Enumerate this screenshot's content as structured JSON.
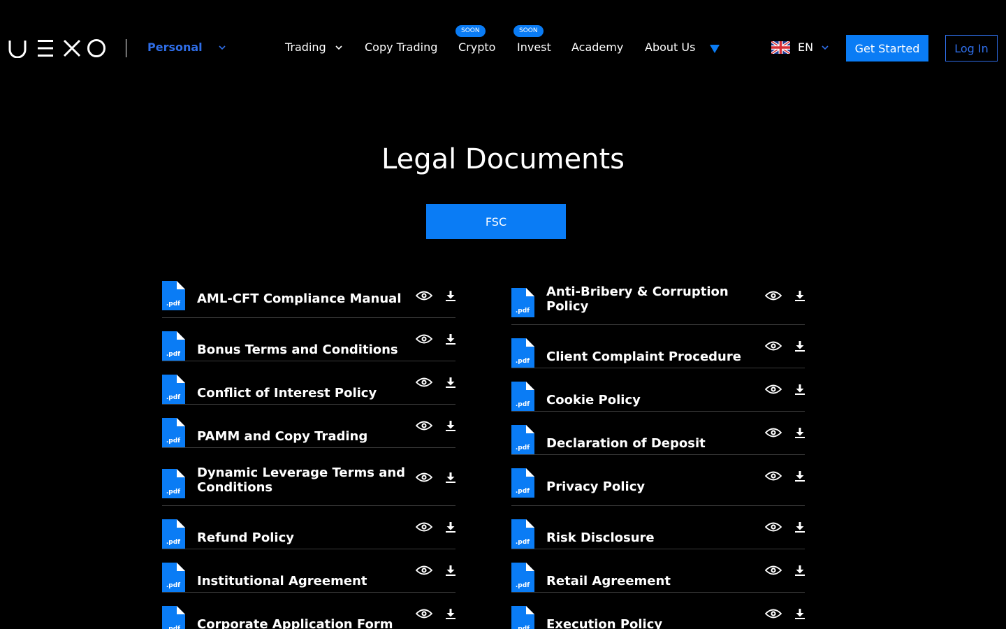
{
  "header": {
    "logo_text": "UEXO",
    "persona": "Personal",
    "nav": [
      {
        "label": "Trading",
        "has_dropdown": true
      },
      {
        "label": "Copy Trading"
      },
      {
        "label": "Crypto",
        "badge": "SOON"
      },
      {
        "label": "Invest",
        "badge": "SOON"
      },
      {
        "label": "Academy"
      },
      {
        "label": "About Us"
      }
    ],
    "more_icon": "triangle-down-icon",
    "language": "EN",
    "language_flag": "uk-flag-icon",
    "get_started": "Get Started",
    "login": "Log In"
  },
  "main": {
    "title": "Legal Documents",
    "tab": "FSC"
  },
  "documents": {
    "left": [
      {
        "title": "AML-CFT Compliance Manual"
      },
      {
        "title": "Bonus Terms and Conditions"
      },
      {
        "title": "Conflict of Interest Policy"
      },
      {
        "title": "PAMM and Copy Trading"
      },
      {
        "title": "Dynamic Leverage Terms and Conditions"
      },
      {
        "title": "Refund Policy"
      },
      {
        "title": "Institutional Agreement"
      },
      {
        "title": "Corporate Application Form"
      }
    ],
    "right": [
      {
        "title": "Anti-Bribery & Corruption Policy"
      },
      {
        "title": "Client Complaint Procedure"
      },
      {
        "title": "Cookie Policy"
      },
      {
        "title": "Declaration of Deposit"
      },
      {
        "title": "Privacy Policy"
      },
      {
        "title": "Risk Disclosure"
      },
      {
        "title": "Retail Agreement"
      },
      {
        "title": "Execution Policy"
      }
    ],
    "file_label": ".pdf"
  },
  "colors": {
    "accent": "#0a7cf5",
    "link": "#2f6ee8",
    "background": "#000000"
  }
}
